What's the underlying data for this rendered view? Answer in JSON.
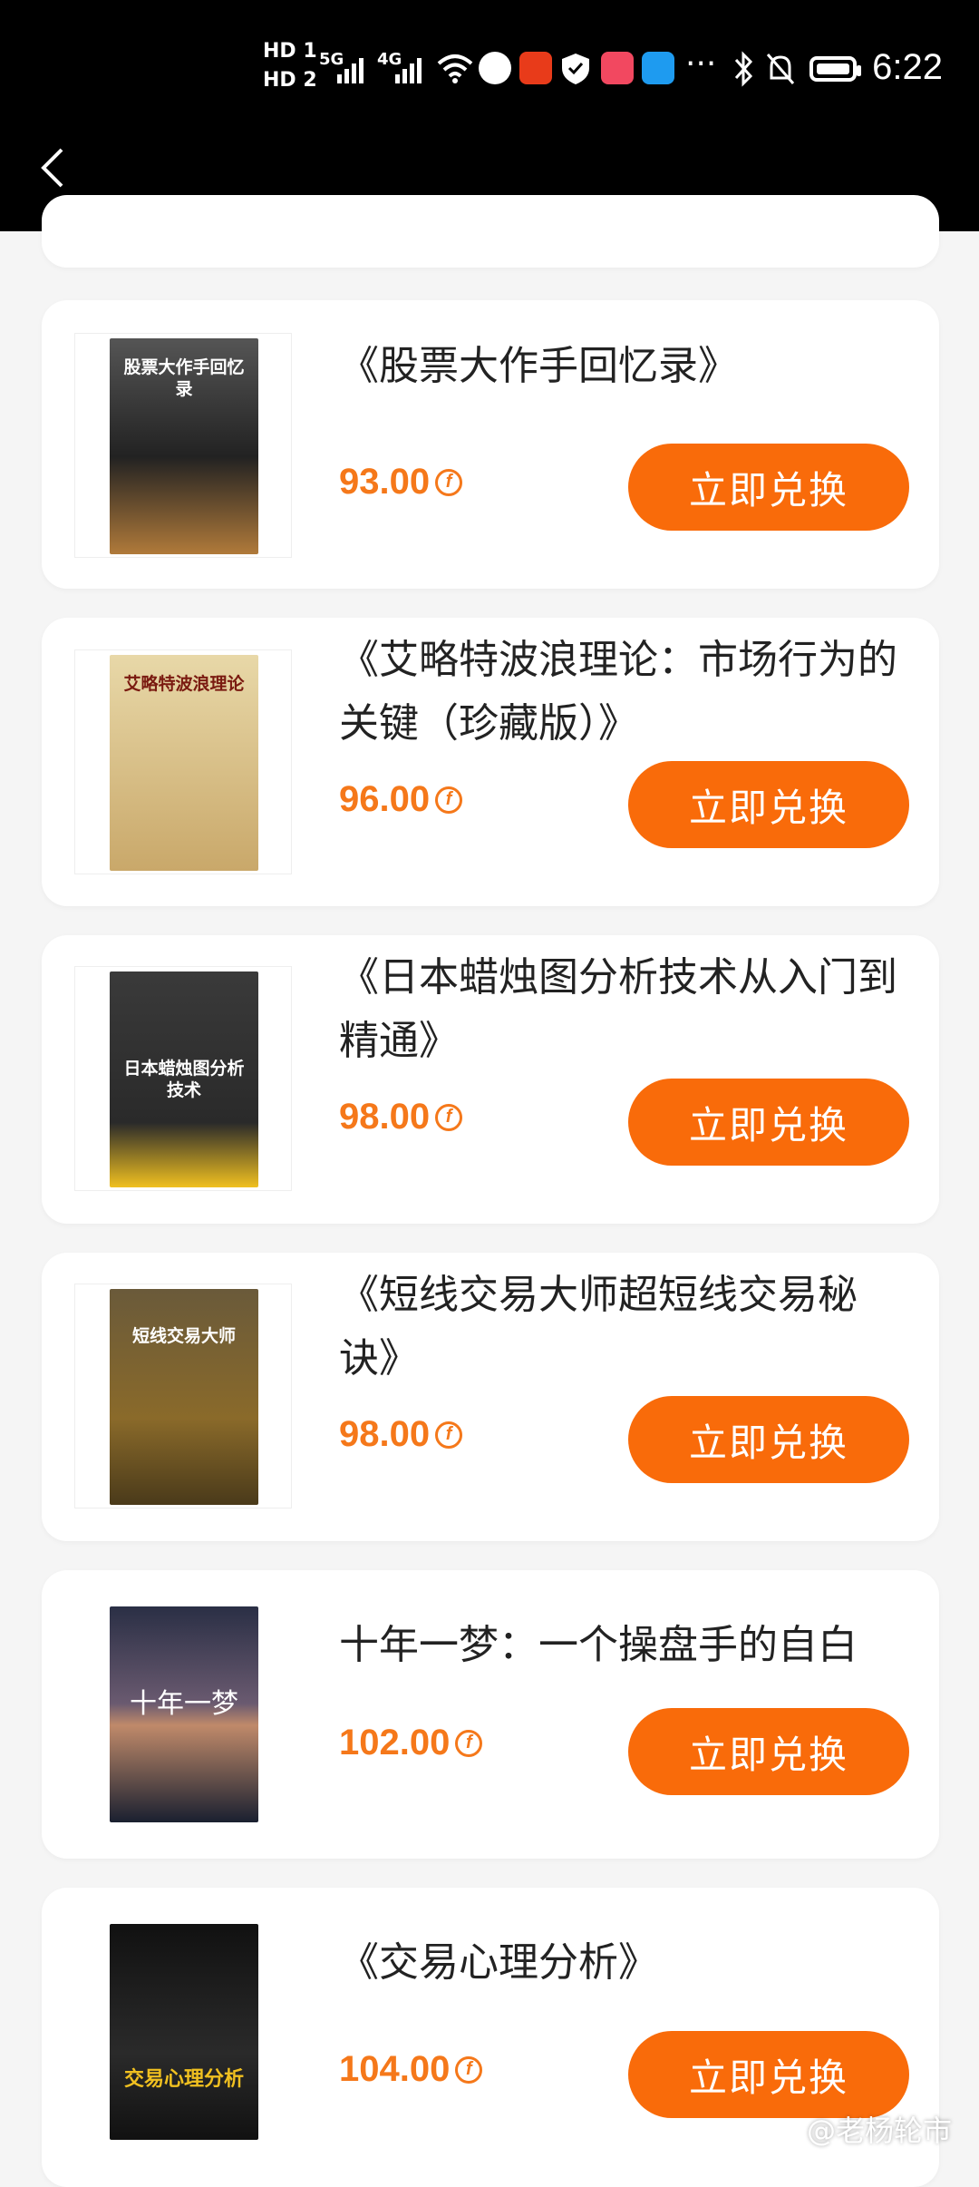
{
  "status_bar": {
    "sim1": "HD 1",
    "sim2": "HD 2",
    "net1": "5G",
    "net2": "4G",
    "time": "6:22"
  },
  "nav": {
    "back_icon": "chevron-left-icon"
  },
  "colors": {
    "accent": "#f96b0a",
    "price": "#f5781a",
    "background": "#f5f5f5"
  },
  "books": [
    {
      "title": "《股票大作手回忆录》",
      "price": "93.00",
      "button": "立即兑换",
      "cover_text": "股票大作手回忆录"
    },
    {
      "title": "《艾略特波浪理论：市场行为的关键（珍藏版）》",
      "price": "96.00",
      "button": "立即兑换",
      "cover_text": "艾略特波浪理论"
    },
    {
      "title": "《日本蜡烛图分析技术从入门到精通》",
      "price": "98.00",
      "button": "立即兑换",
      "cover_text": "日本蜡烛图分析技术"
    },
    {
      "title": "《短线交易大师超短线交易秘诀》",
      "price": "98.00",
      "button": "立即兑换",
      "cover_text": "短线交易大师"
    },
    {
      "title": "十年一梦：一个操盘手的自白",
      "price": "102.00",
      "button": "立即兑换",
      "cover_text": "十年一梦"
    },
    {
      "title": "《交易心理分析》",
      "price": "104.00",
      "button": "立即兑换",
      "cover_text": "交易心理分析"
    }
  ],
  "watermark": "@老杨轮市"
}
